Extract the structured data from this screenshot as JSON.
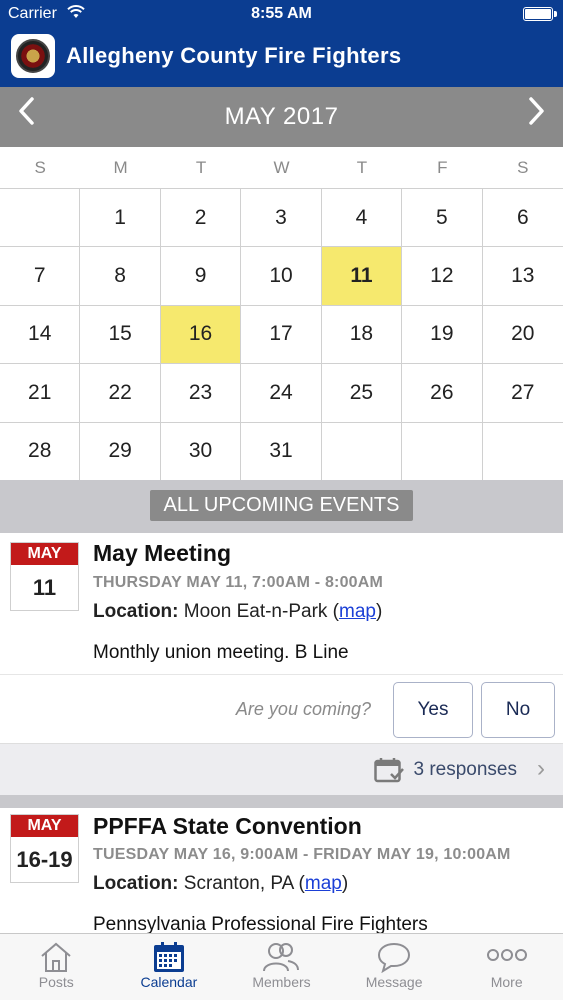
{
  "status_bar": {
    "carrier": "Carrier",
    "time": "8:55 AM"
  },
  "header": {
    "title": "Allegheny County Fire Fighters"
  },
  "calendar": {
    "month_label": "MAY 2017",
    "weekdays": [
      "S",
      "M",
      "T",
      "W",
      "T",
      "F",
      "S"
    ],
    "days": [
      "",
      "1",
      "2",
      "3",
      "4",
      "5",
      "6",
      "7",
      "8",
      "9",
      "10",
      "11",
      "12",
      "13",
      "14",
      "15",
      "16",
      "17",
      "18",
      "19",
      "20",
      "21",
      "22",
      "23",
      "24",
      "25",
      "26",
      "27",
      "28",
      "29",
      "30",
      "31",
      "",
      "",
      ""
    ],
    "highlighted_days": [
      "11",
      "16"
    ],
    "bold_days": [
      "11"
    ],
    "highlight_color": "#f6e96e"
  },
  "upcoming": {
    "label": "ALL UPCOMING EVENTS"
  },
  "events": [
    {
      "badge_month": "MAY",
      "badge_day": "11",
      "title": "May Meeting",
      "when": "THURSDAY MAY 11, 7:00AM - 8:00AM",
      "location_label": "Location:",
      "location": "Moon Eat-n-Park",
      "map_link": "map",
      "description": "Monthly union meeting. B Line",
      "rsvp_question": "Are you coming?",
      "yes_label": "Yes",
      "no_label": "No",
      "responses": "3 responses"
    },
    {
      "badge_month": "MAY",
      "badge_day": "16-19",
      "title": "PPFFA State Convention",
      "when": "TUESDAY MAY 16, 9:00AM - FRIDAY MAY 19, 10:00AM",
      "location_label": "Location:",
      "location": "Scranton, PA",
      "map_link": "map",
      "description": "Pennsylvania Professional Fire Fighters"
    }
  ],
  "tabbar": {
    "tabs": [
      {
        "label": "Posts",
        "icon": "house-icon"
      },
      {
        "label": "Calendar",
        "icon": "calendar-icon",
        "active": true
      },
      {
        "label": "Members",
        "icon": "people-icon"
      },
      {
        "label": "Message",
        "icon": "speech-bubble-icon"
      },
      {
        "label": "More",
        "icon": "more-dots-icon"
      }
    ]
  },
  "colors": {
    "header_bg": "#0b3d91",
    "accent_red": "#c21a1a",
    "link": "#1b3fd6"
  }
}
